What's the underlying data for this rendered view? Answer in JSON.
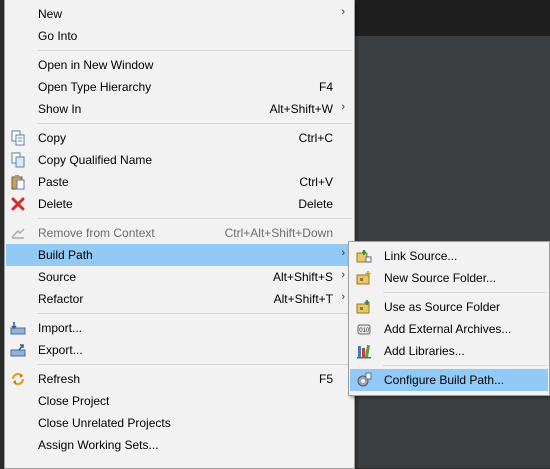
{
  "menu": {
    "new": {
      "label": "New",
      "arrow": "›"
    },
    "go_into": {
      "label": "Go Into"
    },
    "open_new_window": {
      "label": "Open in New Window"
    },
    "open_type_hierarchy": {
      "label": "Open Type Hierarchy",
      "accel": "F4"
    },
    "show_in": {
      "label": "Show In",
      "accel": "Alt+Shift+W",
      "arrow": "›"
    },
    "copy": {
      "label": "Copy",
      "accel": "Ctrl+C",
      "icon": "copy-icon"
    },
    "copy_qualified": {
      "label": "Copy Qualified Name",
      "icon": "copy-qualified-icon"
    },
    "paste": {
      "label": "Paste",
      "accel": "Ctrl+V",
      "icon": "paste-icon"
    },
    "delete": {
      "label": "Delete",
      "accel": "Delete",
      "icon": "delete-icon"
    },
    "remove_context": {
      "label": "Remove from Context",
      "accel": "Ctrl+Alt+Shift+Down",
      "icon": "remove-context-icon"
    },
    "build_path": {
      "label": "Build Path",
      "arrow": "›"
    },
    "source": {
      "label": "Source",
      "accel": "Alt+Shift+S",
      "arrow": "›"
    },
    "refactor": {
      "label": "Refactor",
      "accel": "Alt+Shift+T",
      "arrow": "›"
    },
    "import": {
      "label": "Import...",
      "icon": "import-icon"
    },
    "export": {
      "label": "Export...",
      "icon": "export-icon"
    },
    "refresh": {
      "label": "Refresh",
      "accel": "F5",
      "icon": "refresh-icon"
    },
    "close_project": {
      "label": "Close Project"
    },
    "close_unrelated": {
      "label": "Close Unrelated Projects"
    },
    "assign_working_sets": {
      "label": "Assign Working Sets..."
    }
  },
  "submenu": {
    "link_source": {
      "label": "Link Source...",
      "icon": "link-source-icon"
    },
    "new_source_folder": {
      "label": "New Source Folder...",
      "icon": "new-source-folder-icon"
    },
    "use_as_source_folder": {
      "label": "Use as Source Folder",
      "icon": "use-as-source-folder-icon"
    },
    "add_external_archives": {
      "label": "Add External Archives...",
      "icon": "jar-icon"
    },
    "add_libraries": {
      "label": "Add Libraries...",
      "icon": "libraries-icon"
    },
    "configure_build_path": {
      "label": "Configure Build Path...",
      "icon": "configure-build-path-icon"
    }
  },
  "colors": {
    "selection": "#91c9f7",
    "menu_bg": "#f2f2f2",
    "disabled_text": "#6d6d6d"
  }
}
